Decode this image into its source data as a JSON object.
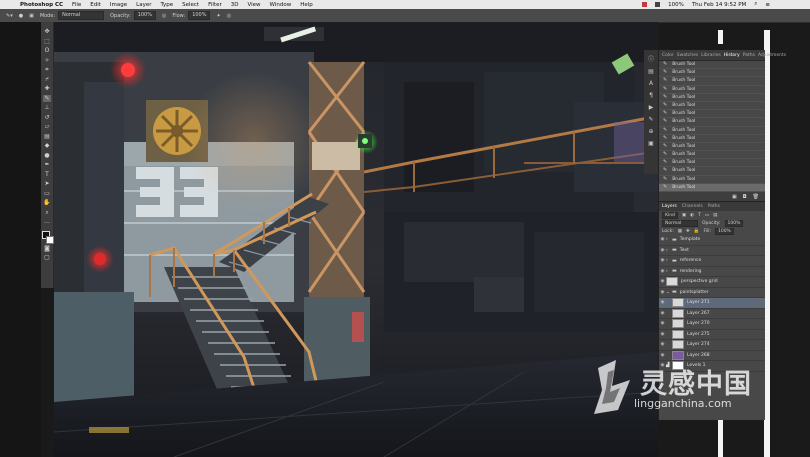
{
  "menubar": {
    "app": "Photoshop CC",
    "items": [
      "File",
      "Edit",
      "Image",
      "Layer",
      "Type",
      "Select",
      "Filter",
      "3D",
      "View",
      "Window",
      "Help"
    ],
    "battery": "100%",
    "clock": "Thu Feb 14  9:52 PM"
  },
  "options": {
    "mode_label": "Mode:",
    "mode_value": "Normal",
    "opacity_label": "Opacity:",
    "opacity_value": "100%",
    "flow_label": "Flow:",
    "flow_value": "100%"
  },
  "history": {
    "tabs": [
      "Color",
      "Swatches",
      "Libraries",
      "History",
      "Paths",
      "Adjustments"
    ],
    "active_tab": "History",
    "items": [
      "Brush Tool",
      "Brush Tool",
      "Brush Tool",
      "Brush Tool",
      "Brush Tool",
      "Brush Tool",
      "Brush Tool",
      "Brush Tool",
      "Brush Tool",
      "Brush Tool",
      "Brush Tool",
      "Brush Tool",
      "Brush Tool",
      "Brush Tool",
      "Brush Tool",
      "Brush Tool"
    ]
  },
  "layers": {
    "tabs": [
      "Layers",
      "Channels",
      "Paths"
    ],
    "active_tab": "Layers",
    "kind_label": "Kind",
    "blend_value": "Normal",
    "opacity_label": "Opacity:",
    "opacity_value": "100%",
    "lock_label": "Lock:",
    "fill_label": "Fill:",
    "fill_value": "100%",
    "rows": [
      {
        "name": "Template",
        "type": "folder"
      },
      {
        "name": "Text",
        "type": "folder"
      },
      {
        "name": "reference",
        "type": "folder"
      },
      {
        "name": "rendering",
        "type": "folder"
      },
      {
        "name": "perspective grid",
        "type": "layer"
      },
      {
        "name": "paintsplatter",
        "type": "folder"
      },
      {
        "name": "Layer 271",
        "type": "layer"
      },
      {
        "name": "Layer 267",
        "type": "layer"
      },
      {
        "name": "Layer 270",
        "type": "layer"
      },
      {
        "name": "Layer 275",
        "type": "layer"
      },
      {
        "name": "Layer 274",
        "type": "layer"
      },
      {
        "name": "Layer 268",
        "type": "purple"
      },
      {
        "name": "Levels 1",
        "type": "adjust"
      }
    ]
  },
  "watermark": {
    "cn": "灵感中国",
    "url": "lingganchina.com"
  }
}
